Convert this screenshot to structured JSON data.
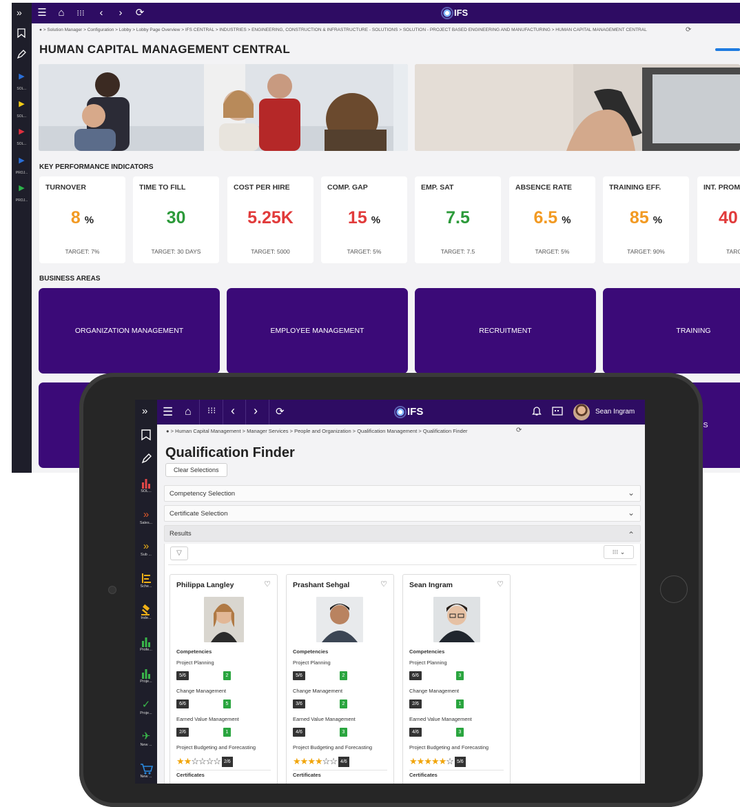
{
  "desktop": {
    "logo": "IFS",
    "breadcrumb": "● > Solution Manager > Configuration > Lobby > Lobby Page Overview > IFS CENTRAL > INDUSTRIES > ENGINEERING, CONSTRUCTION & INFRASTRUCTURE - SOLUTIONS > SOLUTION - PROJECT BASED ENGINEERING AND MANUFACTURING > HUMAN CAPITAL MANAGEMENT CENTRAL",
    "title": "HUMAN CAPITAL MANAGEMENT CENTRAL",
    "side_labels": [
      "SOL...",
      "SOL...",
      "SOL...",
      "PROJ...",
      "PROJ..."
    ],
    "kpi_heading": "KEY PERFORMANCE INDICATORS",
    "kpis": [
      {
        "title": "TURNOVER",
        "value": "8",
        "unit": "%",
        "target": "TARGET: 7%",
        "color": "#f29a23"
      },
      {
        "title": "TIME TO FILL",
        "value": "30",
        "unit": "",
        "target": "TARGET: 30 DAYS",
        "color": "#2c9a3a"
      },
      {
        "title": "COST PER HIRE",
        "value": "5.25K",
        "unit": "",
        "target": "TARGET: 5000",
        "color": "#e13b3b"
      },
      {
        "title": "COMP. GAP",
        "value": "15",
        "unit": "%",
        "target": "TARGET: 5%",
        "color": "#e13b3b"
      },
      {
        "title": "EMP. SAT",
        "value": "7.5",
        "unit": "",
        "target": "TARGET: 7.5",
        "color": "#2c9a3a"
      },
      {
        "title": "ABSENCE RATE",
        "value": "6.5",
        "unit": "%",
        "target": "TARGET: 5%",
        "color": "#f29a23"
      },
      {
        "title": "TRAINING EFF.",
        "value": "85",
        "unit": "%",
        "target": "TARGET: 90%",
        "color": "#f29a23"
      },
      {
        "title": "INT. PROM",
        "value": "40",
        "unit": "",
        "target": "TARG",
        "color": "#e13b3b"
      }
    ],
    "ba_heading": "BUSINESS AREAS",
    "business_areas": [
      "ORGANIZATION MANAGEMENT",
      "EMPLOYEE MANAGEMENT",
      "RECRUITMENT",
      "TRAINING"
    ],
    "partial_area": "ICES"
  },
  "tablet": {
    "logo": "IFS",
    "user_name": "Sean Ingram",
    "breadcrumb": "● > Human Capital Management > Manager Services > People and Organization > Qualification Management > Qualification Finder",
    "title": "Qualification Finder",
    "clear_button": "Clear Selections",
    "sections": {
      "competency": "Competency Selection",
      "certificate": "Certificate Selection",
      "results": "Results"
    },
    "side_items": [
      {
        "label": "SOL...",
        "icon": "bar-chart-icon",
        "color": "#e24848"
      },
      {
        "label": "Sales...",
        "icon": "double-chevron-icon",
        "color": "#e35a2a"
      },
      {
        "label": "Sub ...",
        "icon": "double-chevron-icon",
        "color": "#f0b016"
      },
      {
        "label": "Sche...",
        "icon": "schedule-icon",
        "color": "#f0b016"
      },
      {
        "label": "Inde...",
        "icon": "gavel-icon",
        "color": "#f0b016"
      },
      {
        "label": "Profe...",
        "icon": "bar-chart-icon",
        "color": "#39b54a"
      },
      {
        "label": "Proje...",
        "icon": "bar-chart-icon",
        "color": "#39b54a"
      },
      {
        "label": "Proje...",
        "icon": "check-icon",
        "color": "#39b54a"
      },
      {
        "label": "New ...",
        "icon": "plane-icon",
        "color": "#39b54a"
      },
      {
        "label": "New ...",
        "icon": "cart-icon",
        "color": "#2a8ae0"
      }
    ],
    "card_labels": {
      "competencies": "Competencies",
      "certificates": "Certificates",
      "planning": "Project Planning",
      "change": "Change Management",
      "evm": "Earned Value Management",
      "budget": "Project Budgeting and Forecasting"
    },
    "cards": [
      {
        "name": "Philippa Langley",
        "planning_level": "5/6",
        "planning_count": "2",
        "change_level": "6/6",
        "change_count": "5",
        "evm_level": "2/6",
        "evm_count": "1",
        "stars": 2,
        "stars_label": "2/6"
      },
      {
        "name": "Prashant Sehgal",
        "planning_level": "5/6",
        "planning_count": "2",
        "change_level": "3/6",
        "change_count": "2",
        "evm_level": "4/6",
        "evm_count": "3",
        "stars": 4,
        "stars_label": "4/6"
      },
      {
        "name": "Sean Ingram",
        "planning_level": "6/6",
        "planning_count": "3",
        "change_level": "2/6",
        "change_count": "1",
        "evm_level": "4/6",
        "evm_count": "3",
        "stars": 5,
        "stars_label": "5/6"
      }
    ]
  }
}
